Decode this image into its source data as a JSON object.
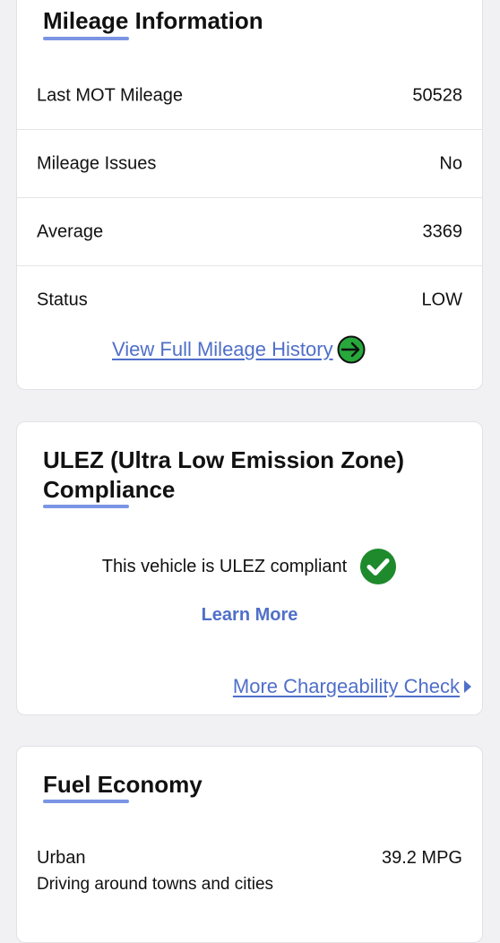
{
  "mileage": {
    "title": "Mileage Information",
    "rows": [
      {
        "label": "Last MOT Mileage",
        "value": "50528"
      },
      {
        "label": "Mileage Issues",
        "value": "No"
      },
      {
        "label": "Average",
        "value": "3369"
      },
      {
        "label": "Status",
        "value": "LOW"
      }
    ],
    "history_link": "View Full Mileage History",
    "history_icon": "arrow-right-circle-icon"
  },
  "ulez": {
    "title_line1": "ULEZ (Ultra Low Emission Zone)",
    "title_line2": "Compliance",
    "status_text": "This vehicle is ULEZ compliant",
    "status_icon": "check-circle-icon",
    "learn_more": "Learn More",
    "chargeability_link": "More Chargeability Check",
    "chargeability_icon": "caret-right-icon"
  },
  "fuel": {
    "title": "Fuel Economy",
    "rows": [
      {
        "label": "Urban",
        "description": "Driving around towns and cities",
        "value": "39.2 MPG"
      }
    ]
  },
  "colors": {
    "accent": "#4f6fc9",
    "underline": "#7b95e4",
    "success_green": "#1e8a2c",
    "arrow_green": "#27a83b"
  }
}
